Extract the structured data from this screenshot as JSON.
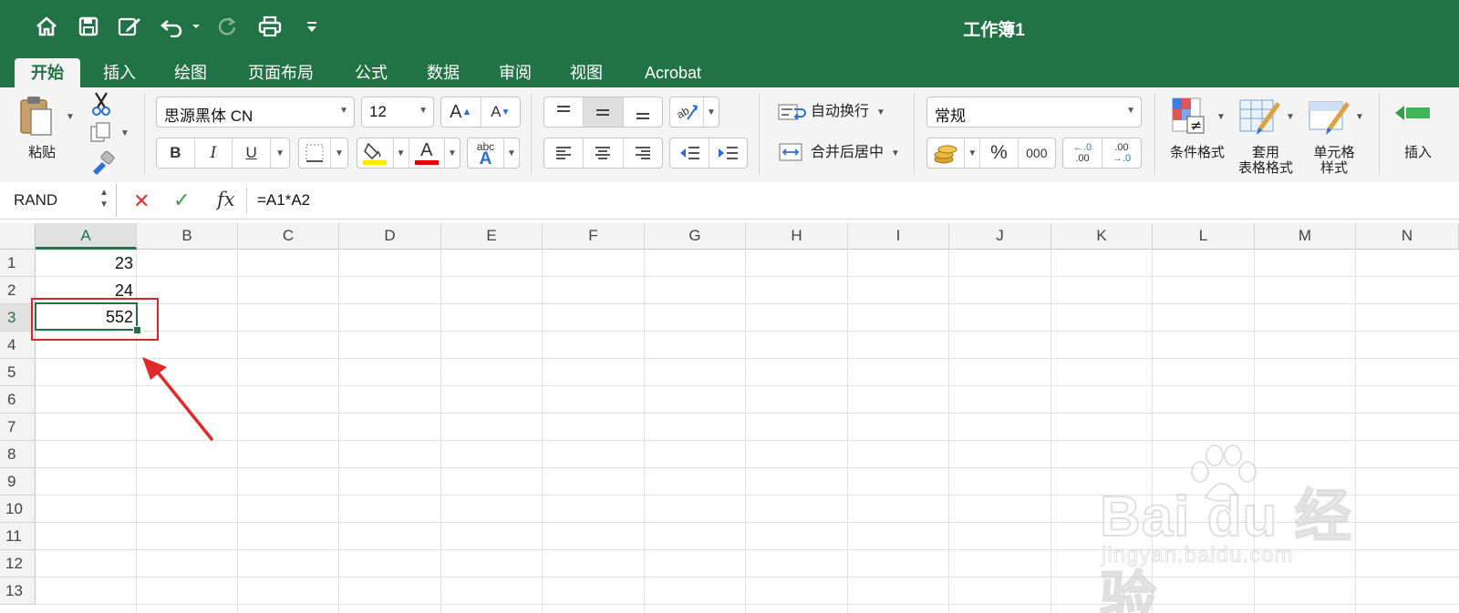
{
  "window": {
    "title": "工作簿1"
  },
  "quick_access": {
    "icons": [
      "home-icon",
      "save-icon",
      "edit-icon",
      "undo-icon",
      "redo-icon",
      "print-icon",
      "customize-icon"
    ]
  },
  "tabs": [
    "开始",
    "插入",
    "绘图",
    "页面布局",
    "公式",
    "数据",
    "审阅",
    "视图",
    "Acrobat"
  ],
  "active_tab": "开始",
  "ribbon": {
    "paste_label": "粘贴",
    "font_name": "思源黑体 CN",
    "font_size": "12",
    "bold": "B",
    "italic": "I",
    "underline": "U",
    "font_color_glyph": "A",
    "phonetic_glyph_top": "abc",
    "phonetic_glyph_bottom": "A",
    "grow_font": "A",
    "shrink_font": "A",
    "wrap_text": "自动换行",
    "merge_center": "合并后居中",
    "number_format": "常规",
    "percent": "%",
    "comma": "000",
    "inc_decimal_top": "←.0",
    "inc_decimal_bottom": ".00",
    "dec_decimal_top": ".00",
    "dec_decimal_bottom": "→.0",
    "conditional_format": "条件格式",
    "format_table_1": "套用",
    "format_table_2": "表格格式",
    "cell_style_1": "单元格",
    "cell_style_2": "样式",
    "insert": "插入",
    "colors": {
      "highlight": "#ffeb00",
      "font_color": "#e00000",
      "accent": "#217346"
    }
  },
  "formula_bar": {
    "name_box": "RAND",
    "cancel": "✕",
    "enter": "✓",
    "fx": "fx",
    "formula": "=A1*A2"
  },
  "sheet": {
    "columns": [
      "A",
      "B",
      "C",
      "D",
      "E",
      "F",
      "G",
      "H",
      "I",
      "J",
      "K",
      "L",
      "M",
      "N"
    ],
    "rows": [
      "1",
      "2",
      "3",
      "4",
      "5",
      "6",
      "7",
      "8",
      "9",
      "10",
      "11",
      "12",
      "13"
    ],
    "selected_column": "A",
    "selected_row": "3",
    "cells": {
      "A1": "23",
      "A2": "24",
      "A3": "552"
    },
    "annotation": "red box around A3 with red arrow pointing to it"
  },
  "watermark": {
    "logo": "Bai du 经验",
    "url": "jingyan.baidu.com"
  }
}
